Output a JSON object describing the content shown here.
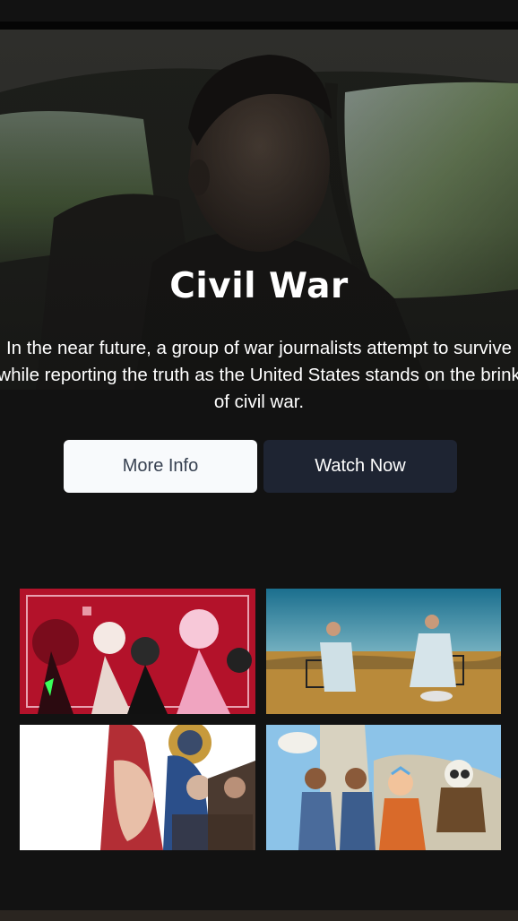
{
  "hero": {
    "title": "Civil War",
    "description": "In the near future, a group of war journalists attempt to survive while reporting the truth as the United States stands on the brink of civil war."
  },
  "buttons": {
    "more_info_label": "More Info",
    "watch_now_label": "Watch Now"
  },
  "colors": {
    "background": "#121212",
    "more_info_bg": "#f8fafc",
    "watch_now_bg": "#1e2432"
  },
  "tiles": [
    {
      "name": "hazbin-hotel-tile"
    },
    {
      "name": "breaking-bad-tile"
    },
    {
      "name": "arcane-tile"
    },
    {
      "name": "avatar-last-airbender-tile"
    }
  ]
}
